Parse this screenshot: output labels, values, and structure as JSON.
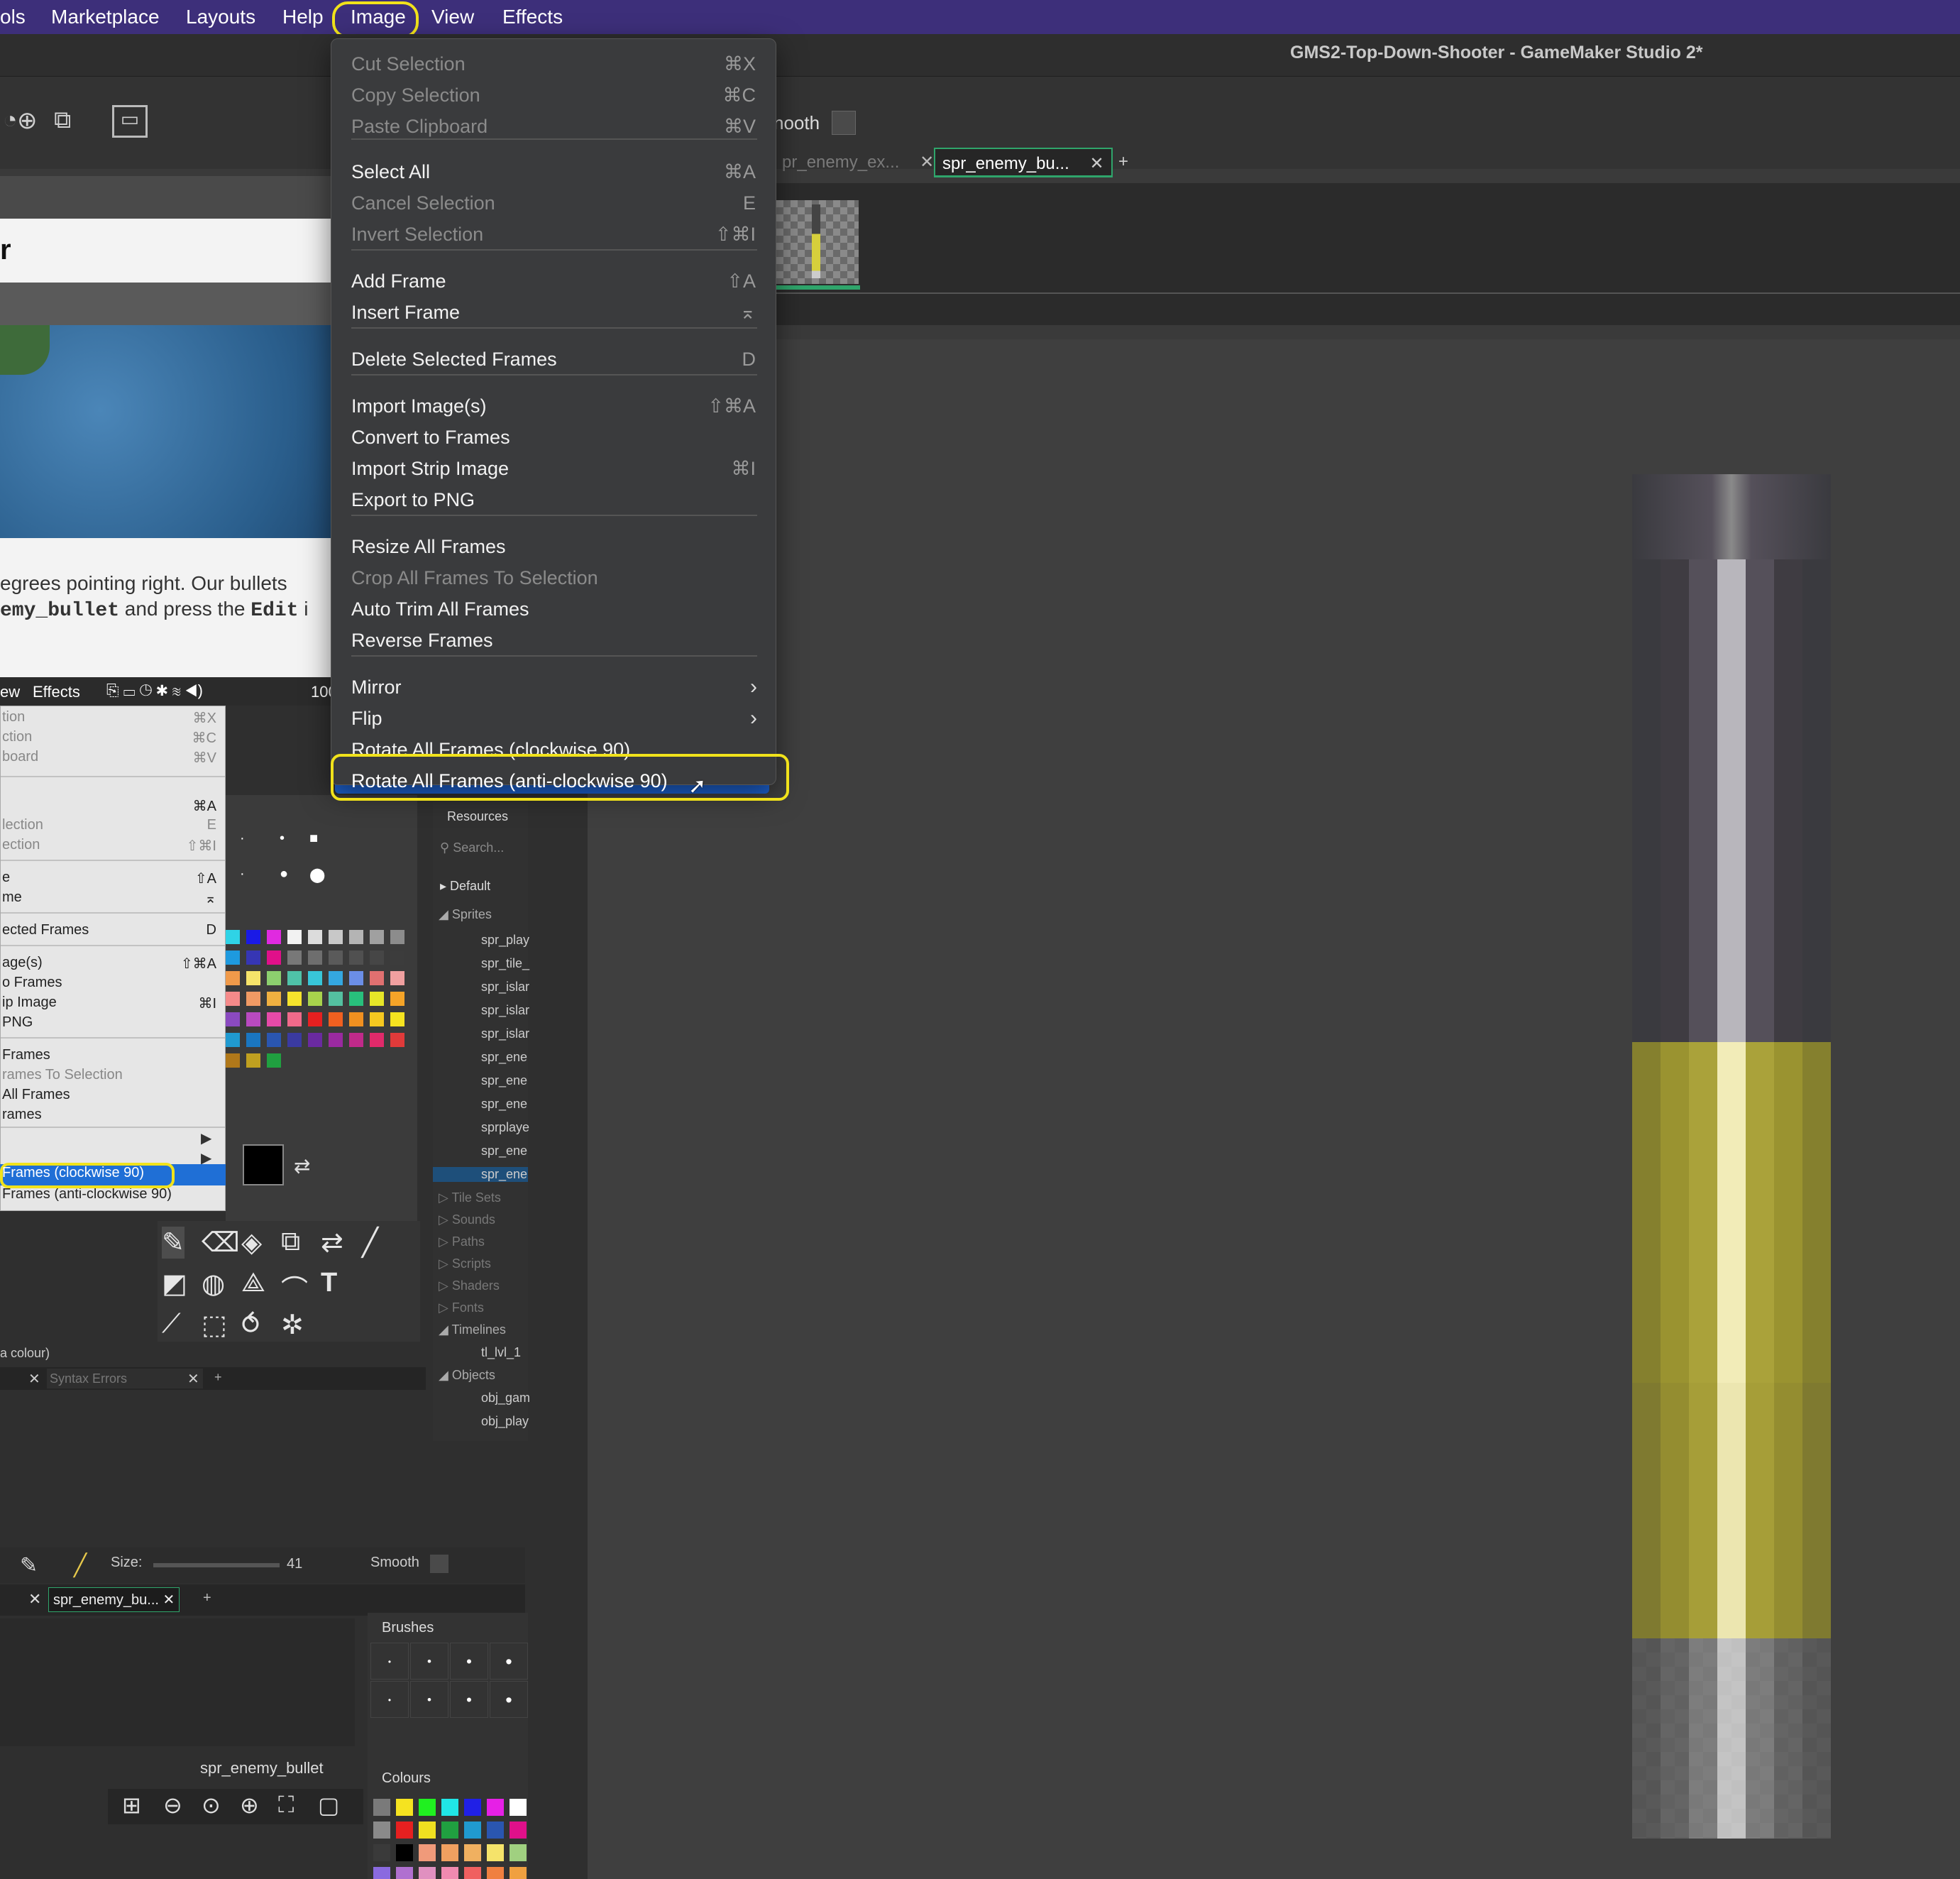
{
  "menubar": {
    "items": [
      "ols",
      "Marketplace",
      "Layouts",
      "Help",
      "Image",
      "View",
      "Effects"
    ],
    "highlighted": "Image"
  },
  "window": {
    "title": "GMS2-Top-Down-Shooter - GameMaker Studio 2*"
  },
  "toolbar": {
    "smooth_label": "nooth"
  },
  "doc_tabs": [
    {
      "label": "pr_enemy_ex...",
      "active": false
    },
    {
      "label": "spr_enemy_bu...",
      "active": true
    },
    {
      "label": "+",
      "active": false
    }
  ],
  "image_menu": {
    "items": [
      {
        "label": "Cut Selection",
        "shortcut": "⌘X",
        "disabled": true
      },
      {
        "label": "Copy Selection",
        "shortcut": "⌘C",
        "disabled": true
      },
      {
        "label": "Paste Clipboard",
        "shortcut": "⌘V",
        "disabled": true
      },
      {
        "label": "Select All",
        "shortcut": "⌘A",
        "disabled": false
      },
      {
        "label": "Cancel Selection",
        "shortcut": "E",
        "disabled": true
      },
      {
        "label": "Invert Selection",
        "shortcut": "⇧⌘I",
        "disabled": true
      },
      {
        "label": "Add Frame",
        "shortcut": "⇧A",
        "disabled": false
      },
      {
        "label": "Insert Frame",
        "shortcut": "⌅",
        "disabled": false
      },
      {
        "label": "Delete Selected Frames",
        "shortcut": "D",
        "disabled": false
      },
      {
        "label": "Import Image(s)",
        "shortcut": "⇧⌘A",
        "disabled": false
      },
      {
        "label": "Convert to Frames",
        "shortcut": "",
        "disabled": false
      },
      {
        "label": "Import Strip Image",
        "shortcut": "⌘I",
        "disabled": false
      },
      {
        "label": "Export to PNG",
        "shortcut": "",
        "disabled": false
      },
      {
        "label": "Resize All Frames",
        "shortcut": "",
        "disabled": false
      },
      {
        "label": "Crop All Frames To Selection",
        "shortcut": "",
        "disabled": true
      },
      {
        "label": "Auto Trim All Frames",
        "shortcut": "",
        "disabled": false
      },
      {
        "label": "Reverse Frames",
        "shortcut": "",
        "disabled": false
      },
      {
        "label": "Mirror",
        "shortcut": "›",
        "disabled": false
      },
      {
        "label": "Flip",
        "shortcut": "›",
        "disabled": false
      },
      {
        "label": "Rotate All Frames (clockwise 90)",
        "shortcut": "",
        "disabled": false
      },
      {
        "label": "Rotate All Frames (anti-clockwise 90)",
        "shortcut": "",
        "disabled": false
      }
    ],
    "selected": "Rotate All Frames (anti-clockwise 90)"
  },
  "tutorial": {
    "heading_fragment": "r",
    "line1": "egrees pointing right. Our bullets",
    "line2_code": "emy_bullet",
    "line2_mid": " and press the ",
    "line2_code2": "Edit",
    "line2_end": " i"
  },
  "inner_screenshot": {
    "menubar": [
      "ew",
      "Effects",
      "100"
    ],
    "menu_items": [
      {
        "label": "tion",
        "shortcut": "⌘X"
      },
      {
        "label": "ction",
        "shortcut": "⌘C"
      },
      {
        "label": "board",
        "shortcut": "⌘V"
      },
      {
        "label": "",
        "shortcut": "⌘A"
      },
      {
        "label": "lection",
        "shortcut": "E"
      },
      {
        "label": "ection",
        "shortcut": "⇧⌘I"
      },
      {
        "label": "e",
        "shortcut": "⇧A"
      },
      {
        "label": "me",
        "shortcut": "⌅"
      },
      {
        "label": "ected Frames",
        "shortcut": "D"
      },
      {
        "label": "age(s)",
        "shortcut": "⇧⌘A"
      },
      {
        "label": "o Frames",
        "shortcut": ""
      },
      {
        "label": "ip Image",
        "shortcut": "⌘I"
      },
      {
        "label": "PNG",
        "shortcut": ""
      },
      {
        "label": "Frames",
        "shortcut": ""
      },
      {
        "label": "rames To Selection",
        "shortcut": ""
      },
      {
        "label": "All Frames",
        "shortcut": ""
      },
      {
        "label": "rames",
        "shortcut": ""
      },
      {
        "label": "Frames (clockwise 90)",
        "shortcut": ""
      },
      {
        "label": "Frames (anti-clockwise 90)",
        "shortcut": ""
      }
    ],
    "resources": {
      "title": "Resources",
      "search_placeholder": "Search...",
      "default": "Default",
      "sprites_header": "Sprites",
      "sprites": [
        "spr_play",
        "spr_tile_",
        "spr_islar",
        "spr_islar",
        "spr_islar",
        "spr_ene",
        "spr_ene",
        "spr_ene",
        "sprplaye",
        "spr_ene",
        "spr_ene"
      ],
      "categories": [
        "Tile Sets",
        "Sounds",
        "Paths",
        "Scripts",
        "Shaders",
        "Fonts"
      ],
      "timelines_header": "Timelines",
      "timelines": [
        "tl_lvl_1"
      ],
      "objects_header": "Objects",
      "objects": [
        "obj_gam",
        "obj_play"
      ]
    },
    "status_colour": "a colour)",
    "output_tab": "Syntax Errors",
    "size_label": "Size:",
    "size_value": "41",
    "smooth_label": "Smooth",
    "sprite_tab": "spr_enemy_bu...",
    "sprite_name": "spr_enemy_bullet",
    "brushes_title": "Brushes",
    "colours_title": "Colours"
  },
  "colors": {
    "menubar_bg": "#3d2f7a",
    "highlight_ring": "#f1e21b",
    "selection_blue": "#1d62d0",
    "bullet_yellow": "#b3ab3a"
  }
}
